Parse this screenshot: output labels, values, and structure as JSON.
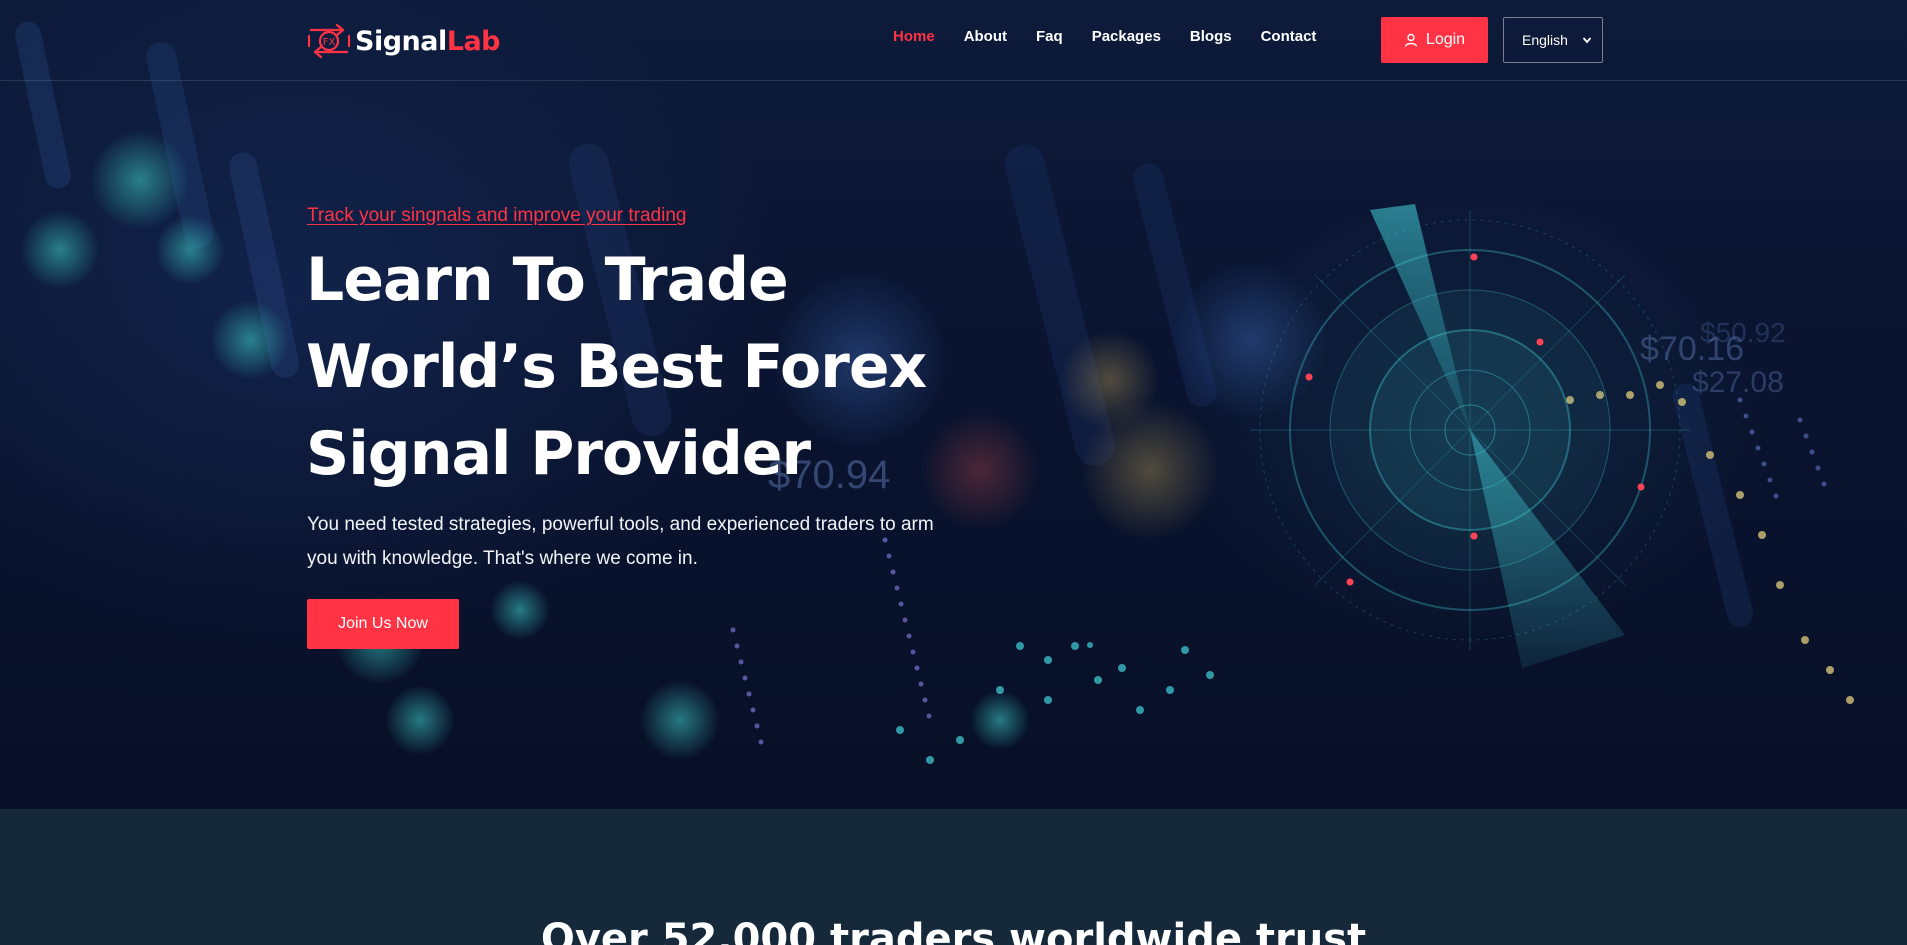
{
  "brand": {
    "name_part1": "Signal",
    "name_part2": "Lab",
    "mark_text": "FX"
  },
  "nav": {
    "items": [
      {
        "label": "Home",
        "active": true
      },
      {
        "label": "About",
        "active": false
      },
      {
        "label": "Faq",
        "active": false
      },
      {
        "label": "Packages",
        "active": false
      },
      {
        "label": "Blogs",
        "active": false
      },
      {
        "label": "Contact",
        "active": false
      }
    ]
  },
  "header": {
    "login_label": "Login",
    "language": "English"
  },
  "hero": {
    "tagline": "Track your singnals and improve your trading",
    "title_lines": [
      "Learn To Trade",
      "World’s Best Forex",
      "Signal Provider"
    ],
    "description": "You need tested strategies, powerful tools, and experienced traders to arm you with knowledge. That's where we come in.",
    "cta_label": "Join Us Now",
    "background_figures": [
      "$70.94",
      "$70.16",
      "$27.08",
      "$50.92"
    ]
  },
  "band": {
    "heading": "Over 52,000 traders worldwide trust"
  },
  "colors": {
    "accent": "#ff3344",
    "hero_bg": "#0b1530",
    "band_bg": "#16293a",
    "radar": "#3fc6cf"
  }
}
